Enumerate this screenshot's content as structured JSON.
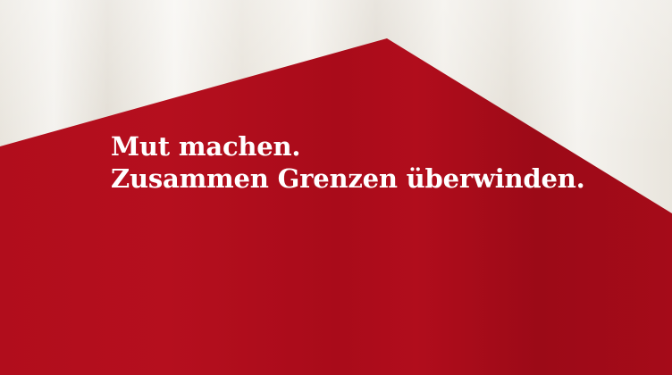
{
  "hero": {
    "headline_line1": "Mut machen.",
    "headline_line2": "Zusammen Grenzen überwinden."
  },
  "colors": {
    "brand_red": "#b20c1b",
    "brand_red_dark": "#8f0a16",
    "text": "#ffffff"
  }
}
